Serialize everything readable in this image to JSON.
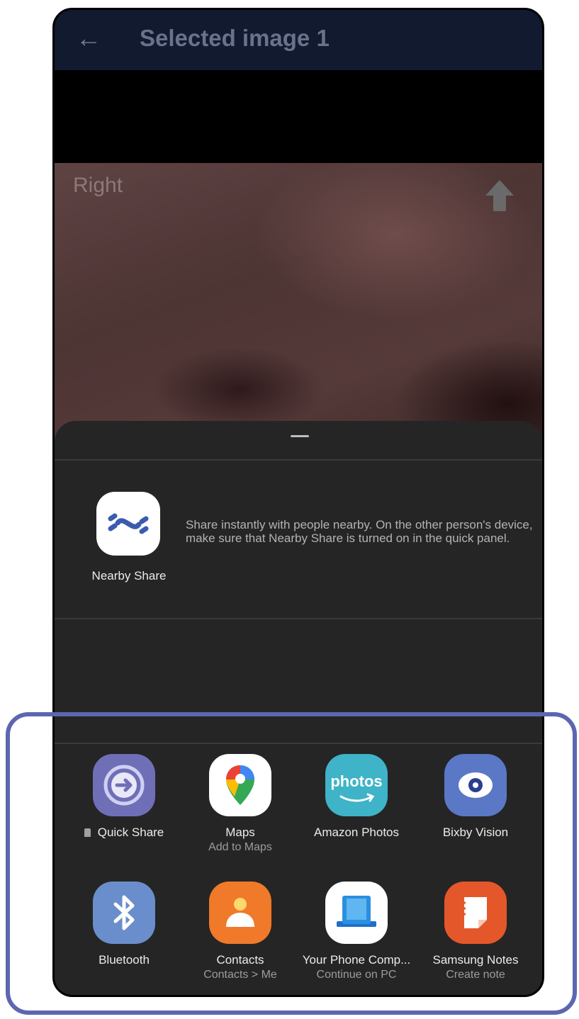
{
  "appbar": {
    "title": "Selected image 1",
    "back_icon": "arrow-left-icon"
  },
  "image": {
    "side_label": "Right",
    "upload_icon": "upload-arrow-icon"
  },
  "share_sheet": {
    "nearby": {
      "label": "Nearby Share",
      "description": "Share instantly with people nearby. On the other person's device, make sure that Nearby Share is turned on in the quick panel."
    },
    "apps": [
      {
        "name": "Quick Share",
        "sub": "",
        "icon": "quick-share-icon",
        "pinned": true,
        "color": "#6f6fb8"
      },
      {
        "name": "Maps",
        "sub": "Add to Maps",
        "icon": "maps-icon",
        "color": "#ffffff"
      },
      {
        "name": "Amazon Photos",
        "sub": "",
        "icon": "amazon-photos-icon",
        "icon_text": "photos",
        "color": "#3fb3c7"
      },
      {
        "name": "Bixby Vision",
        "sub": "",
        "icon": "bixby-vision-icon",
        "color": "#5a78c6"
      },
      {
        "name": "Bluetooth",
        "sub": "",
        "icon": "bluetooth-icon",
        "color": "#6a8ecb"
      },
      {
        "name": "Contacts",
        "sub": "Contacts > Me",
        "icon": "contacts-icon",
        "color": "#f07a2a"
      },
      {
        "name": "Your Phone Comp...",
        "sub": "Continue on PC",
        "icon": "your-phone-icon",
        "color": "#ffffff"
      },
      {
        "name": "Samsung Notes",
        "sub": "Create note",
        "icon": "samsung-notes-icon",
        "color": "#e4572b"
      }
    ]
  },
  "highlight_color": "#5d66b1"
}
